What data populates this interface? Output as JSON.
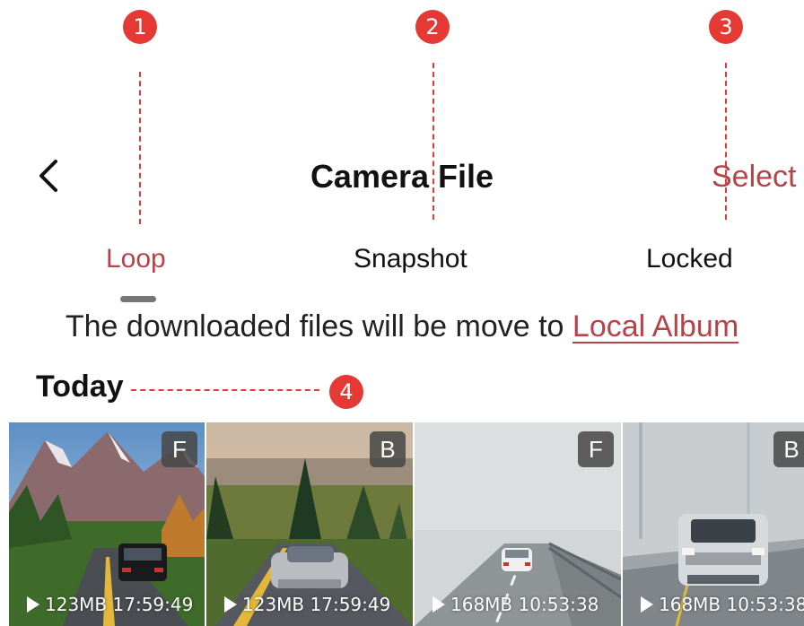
{
  "markers": [
    "1",
    "2",
    "3",
    "4"
  ],
  "header": {
    "title": "Camera File",
    "select_label": "Select"
  },
  "tabs": [
    {
      "label": "Loop",
      "active": true
    },
    {
      "label": "Snapshot",
      "active": false
    },
    {
      "label": "Locked",
      "active": false
    }
  ],
  "notice": {
    "text": "The downloaded files will be move to ",
    "link": "Local Album"
  },
  "section": {
    "title": "Today"
  },
  "files": [
    {
      "badge": "F",
      "size": "123MB",
      "time": "17:59:49"
    },
    {
      "badge": "B",
      "size": "123MB",
      "time": "17:59:49"
    },
    {
      "badge": "F",
      "size": "168MB",
      "time": "10:53:38"
    },
    {
      "badge": "B",
      "size": "168MB",
      "time": "10:53:38"
    }
  ],
  "colors": {
    "accent": "#b5434a",
    "marker": "#e53935",
    "badge_bg": "#464646"
  }
}
